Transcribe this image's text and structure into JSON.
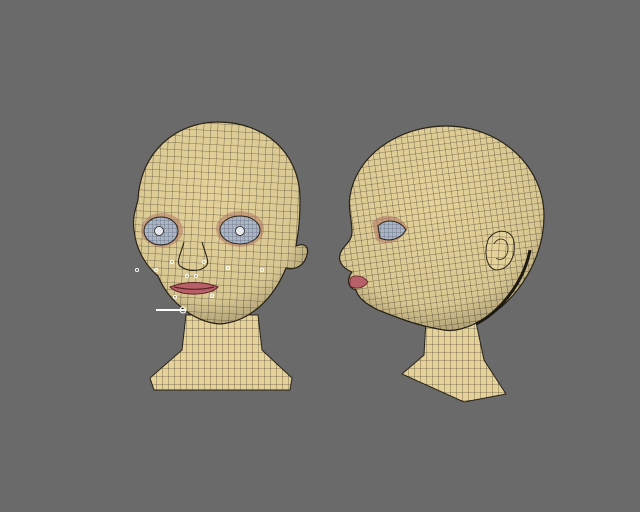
{
  "viewport": {
    "background_color": "#6a6a6a"
  },
  "models": [
    {
      "id": "front",
      "label": "head-front-view"
    },
    {
      "id": "side",
      "label": "head-side-view"
    }
  ],
  "colors": {
    "skin": "#e5d29a",
    "skin_shadow": "#c9b47a",
    "wire": "#2a2418",
    "eye_white": "#a9b4c4",
    "eye_lid": "#b07a68",
    "lip": "#b8606a",
    "mouth_dark": "#5a2424",
    "selection": "#ffffff"
  }
}
